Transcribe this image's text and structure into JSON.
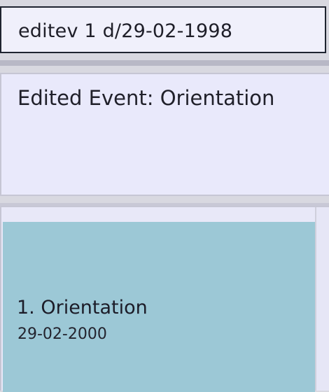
{
  "command_box": {
    "value": "editev 1 d/29-02-1998"
  },
  "result_display": {
    "message": "Edited Event: Orientation"
  },
  "event_list": {
    "items": [
      {
        "index": "1.",
        "title": "1.  Orientation",
        "date": "29-02-2000"
      }
    ]
  },
  "colors": {
    "command_background": "#f0f0fb",
    "result_background": "#e9e9fb",
    "card_background": "#9cc8d6",
    "divider": "#b8b8c6"
  }
}
